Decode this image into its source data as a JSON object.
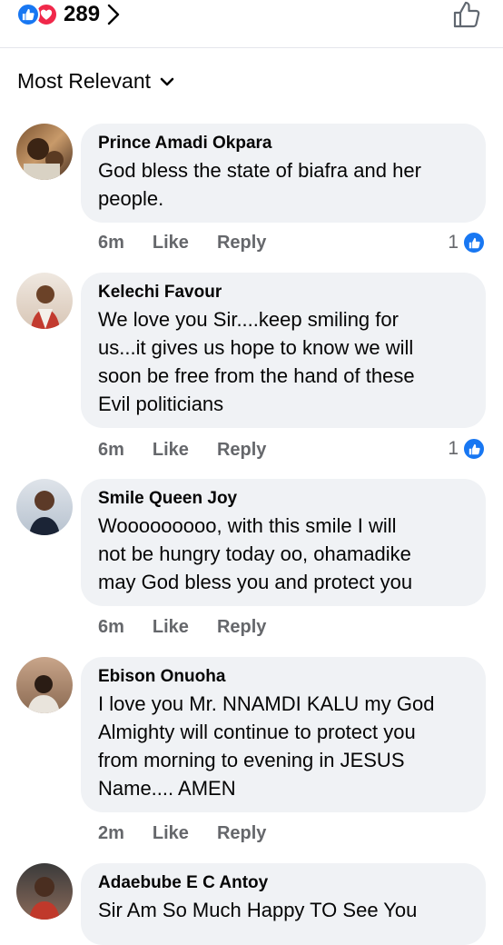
{
  "header": {
    "reaction_count": "289",
    "reaction_icons": [
      "like-reaction-icon",
      "love-reaction-icon"
    ]
  },
  "sort": {
    "label": "Most Relevant"
  },
  "comments": [
    {
      "author": "Prince Amadi Okpara",
      "text": "God bless the state of biafra and her\npeople.",
      "time": "6m",
      "like_label": "Like",
      "reply_label": "Reply",
      "reactions": "1"
    },
    {
      "author": "Kelechi Favour",
      "text": "We love you Sir....keep smiling for\nus...it gives us hope to know we will\nsoon be free from the hand of these\nEvil politicians",
      "time": "6m",
      "like_label": "Like",
      "reply_label": "Reply",
      "reactions": "1"
    },
    {
      "author": "Smile Queen Joy",
      "text": "Wooooooooo, with this smile  I will\nnot be hungry today oo, ohamadike\nmay God bless you and protect you",
      "time": "6m",
      "like_label": "Like",
      "reply_label": "Reply"
    },
    {
      "author": "Ebison Onuoha",
      "text": "I love you Mr. NNAMDI KALU my God\nAlmighty will continue to protect you\nfrom morning to evening in JESUS\nName.... AMEN",
      "time": "2m",
      "like_label": "Like",
      "reply_label": "Reply"
    },
    {
      "author": "Adaebube E C Antoy",
      "text": "Sir Am So Much Happy TO See You"
    }
  ],
  "colors": {
    "facebook_blue": "#1877f2",
    "love_red": "#f0284a",
    "bubble_bg": "#f0f2f5",
    "meta_gray": "#65676b"
  }
}
